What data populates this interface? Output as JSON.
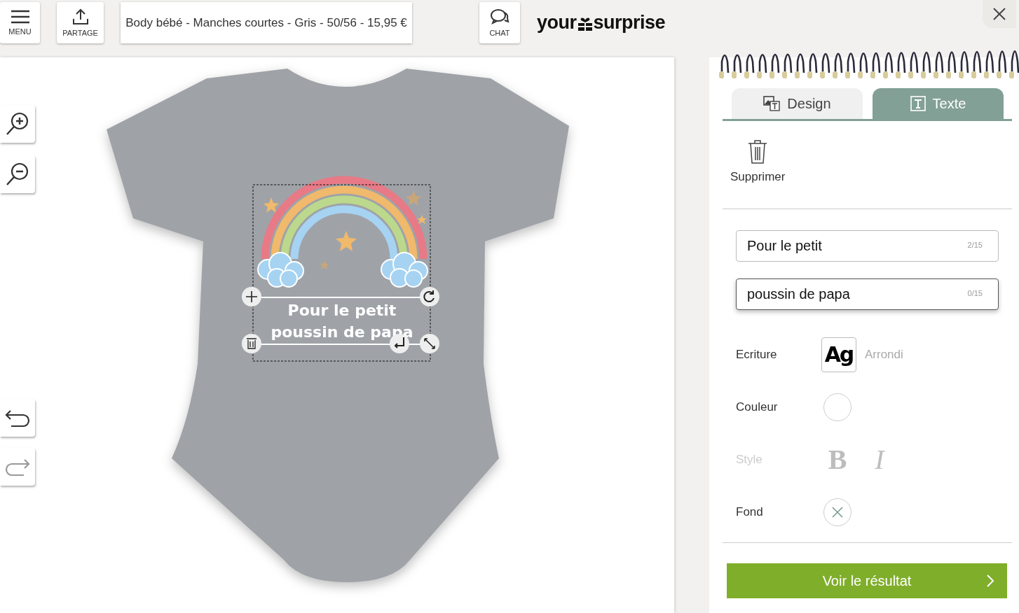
{
  "header": {
    "menu_label": "MENU",
    "share_label": "PARTAGE",
    "product_title": "Body bébé - Manches courtes - Gris - 50/56 - 15,95 €",
    "chat_label": "CHAT",
    "logo_left": "your",
    "logo_right": "surprise"
  },
  "print_lines": [
    "Pour le petit",
    "poussin de papa"
  ],
  "tabs": [
    {
      "label": "Design",
      "kind": "design",
      "selected": false
    },
    {
      "label": "Texte",
      "kind": "text",
      "selected": true
    }
  ],
  "delete_label": "Supprimer",
  "text_fields": [
    {
      "value": "Pour le petit",
      "counter": "2/15",
      "focused": false
    },
    {
      "value": "poussin de papa",
      "counter": "0/15",
      "focused": true
    }
  ],
  "options": [
    {
      "kind": "font",
      "label": "Ecriture",
      "sample": "Ag",
      "value": "Arrondi",
      "disabled": false
    },
    {
      "kind": "color",
      "label": "Couleur",
      "color": "#ffffff",
      "disabled": false
    },
    {
      "kind": "style",
      "label": "Style",
      "bold": "B",
      "italic": "I",
      "disabled": true
    },
    {
      "kind": "background",
      "label": "Fond",
      "disabled": false
    }
  ],
  "primary_button": "Voir le résultat"
}
